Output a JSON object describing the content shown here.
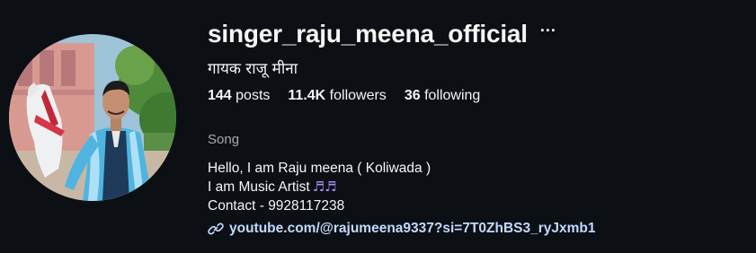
{
  "profile": {
    "username": "singer_raju_meena_official",
    "more_icon": "more-options-icon",
    "full_name": "गायक राजू मीना",
    "stats": {
      "posts_count": "144",
      "posts_label": "posts",
      "followers_count": "11.4K",
      "followers_label": "followers",
      "following_count": "36",
      "following_label": "following"
    },
    "category": "Song",
    "bio": {
      "line1": "Hello, I am Raju meena ( Koliwada )",
      "line2": "I am Music Artist",
      "line2_emoji": "♬♬",
      "line3": "Contact - 9928117238"
    },
    "link": {
      "icon": "link-icon",
      "text": "youtube.com/@rajumeena9337?si=7T0ZhBS3_ryJxmb1"
    }
  },
  "colors": {
    "background": "#0c1014",
    "text": "#f5f5f5",
    "secondary_text": "#a8a8a8",
    "link": "#c2d9ff",
    "emoji": "#a78bfa"
  }
}
